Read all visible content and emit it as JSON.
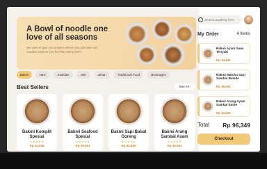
{
  "hero": {
    "title": "A Bowl of noodle one love of all seasons",
    "subtitle": "We want to give you a space where you can taste our noodles anytime you feel like eating them."
  },
  "categories": [
    {
      "label": "Bakmi",
      "active": true
    },
    {
      "label": "Nasi",
      "active": false
    },
    {
      "label": "Kwetiaw",
      "active": false
    },
    {
      "label": "Mie",
      "active": false
    },
    {
      "label": "Bihun",
      "active": false
    },
    {
      "label": "Traditional Food",
      "active": false
    },
    {
      "label": "Beverages",
      "active": false
    }
  ],
  "best_sellers": {
    "title": "Best Sellers",
    "see_all": "See All",
    "items": [
      {
        "name": "Bakmi Komplit Spesial",
        "price": "Rp 34,545",
        "rating": "★★★★★"
      },
      {
        "name": "Bakmi Seafood Spesial",
        "price": "Rp 39,091",
        "rating": "★★★★★"
      },
      {
        "name": "Bakmi Sapi Babat Goreng",
        "price": "Rp 34,545",
        "rating": "★★★★★"
      },
      {
        "name": "Bakmi Arang Sambal Asam",
        "price": "Rp 39,091",
        "rating": "★★★★★"
      }
    ]
  },
  "search": {
    "placeholder": "Search anything here"
  },
  "order": {
    "title": "My Order",
    "count": "4 Items",
    "items": [
      {
        "name": "Bakmi Ayam Saus Teriyaki",
        "price": "Rp 34,545"
      },
      {
        "name": "Bakmi Matcha Sapi Sambal Balado",
        "price": "Rp 39,091"
      },
      {
        "name": "Bakmi Arang Ayam Sambal Embe",
        "price": "Rp 34,545"
      }
    ],
    "total_label": "Total",
    "total_value": "Rp 96,349",
    "checkout": "Checkout"
  },
  "colors": {
    "accent": "#f2c978",
    "price": "#d4832a",
    "hero_bg": "#f7dfb3"
  }
}
